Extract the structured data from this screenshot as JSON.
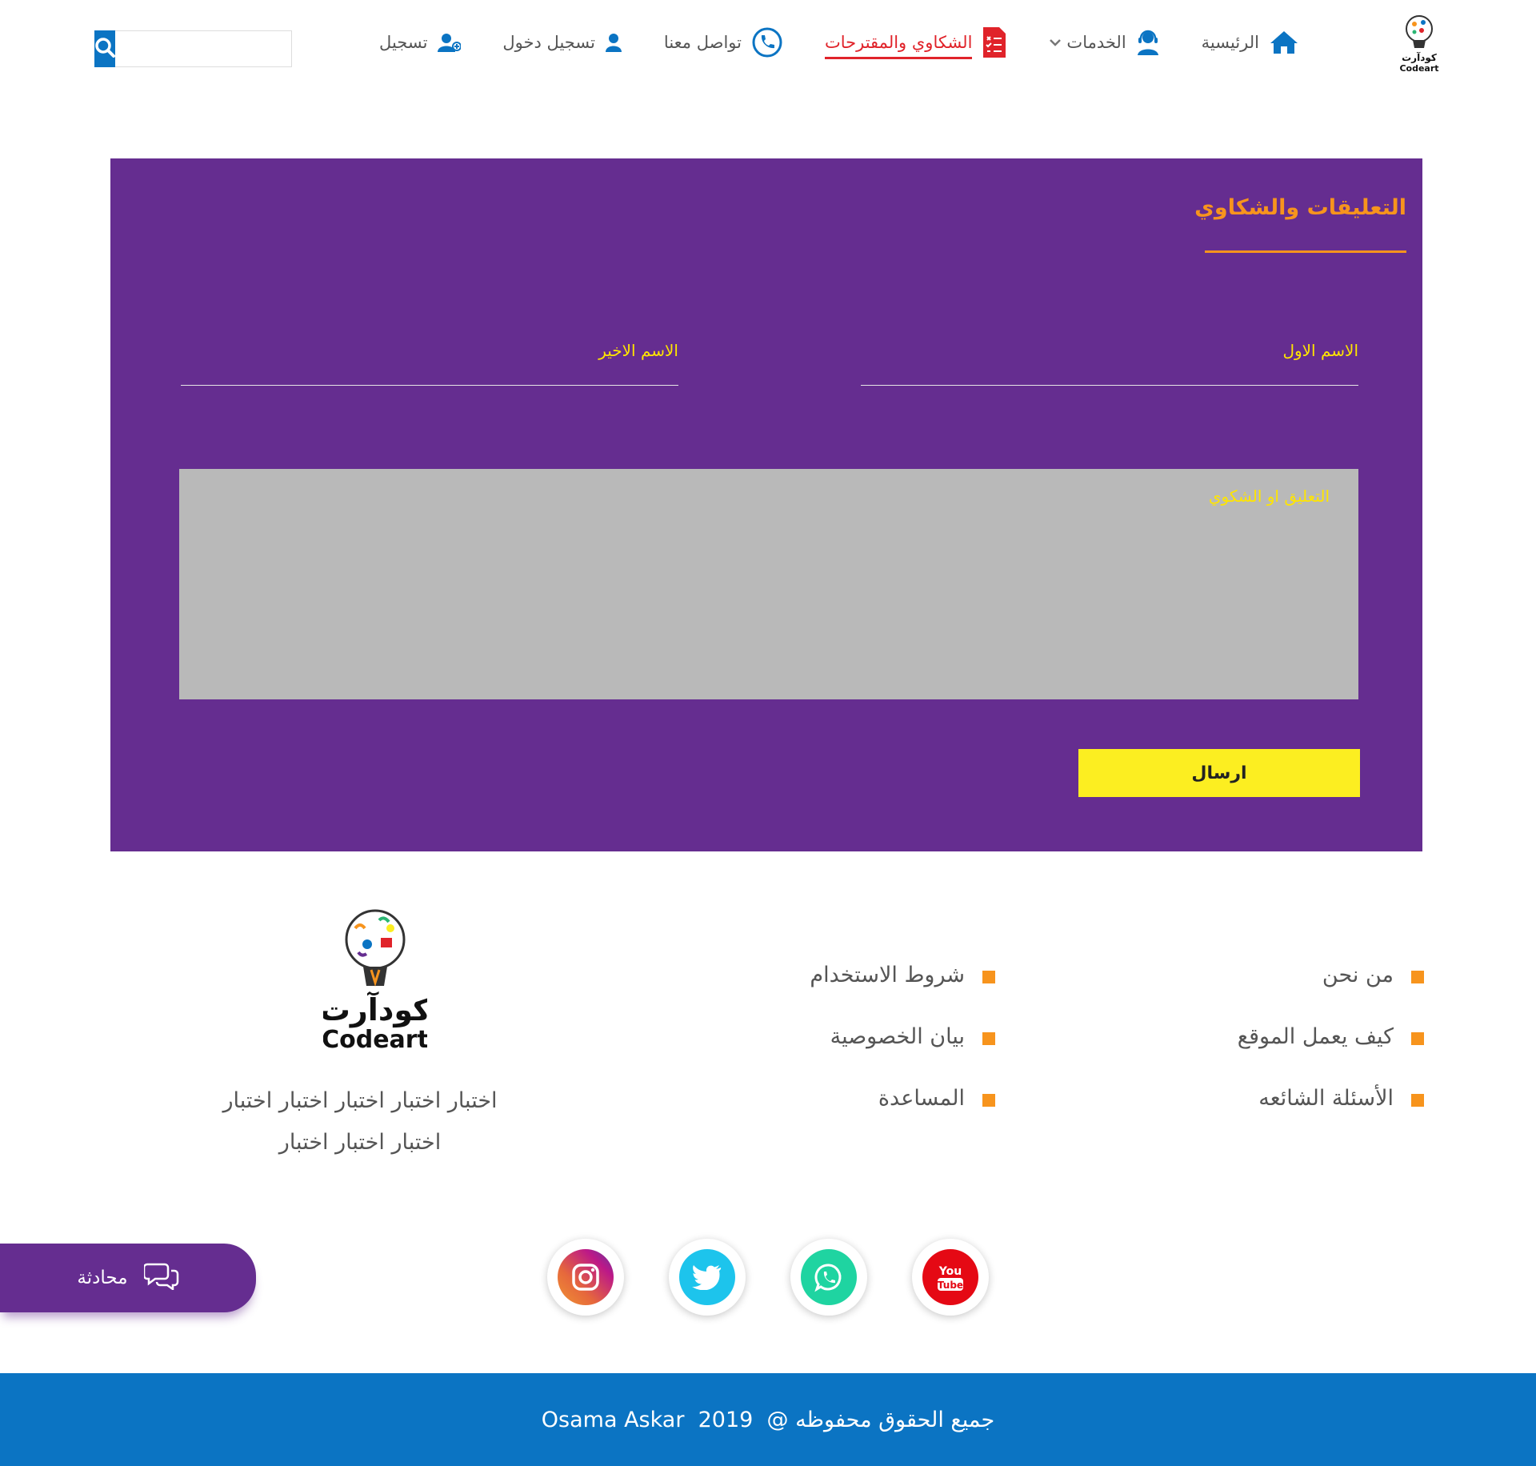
{
  "header": {
    "logo": {
      "text_ar": "كودآرت",
      "text_en": "Codeart"
    },
    "nav": [
      {
        "label": "الرئيسية",
        "icon": "home-icon"
      },
      {
        "label": "الخدمات",
        "icon": "support-agent-icon",
        "has_dropdown": true
      },
      {
        "label": "الشكاوي والمقترحات",
        "icon": "complaints-list-icon",
        "active": true
      },
      {
        "label": "تواصل معنا",
        "icon": "phone-icon"
      },
      {
        "label": "تسجيل دخول",
        "icon": "user-icon"
      },
      {
        "label": "تسجيل",
        "icon": "user-add-icon"
      }
    ],
    "search": {
      "placeholder": "",
      "button_icon": "search-icon"
    }
  },
  "form": {
    "title": "التعليقات والشكاوي",
    "first_name_label": "الاسم الاول",
    "last_name_label": "الاسم الاخير",
    "comment_label": "التعليق او الشكوي",
    "submit_label": "ارسال"
  },
  "footer": {
    "col1": [
      "من نحن",
      "كيف يعمل الموقع",
      "الأسئلة الشائعه"
    ],
    "col2": [
      "شروط الاستخدام",
      "بيان الخصوصية",
      "المساعدة"
    ],
    "about_line1": "اختبار اختبار اختبار اختبار اختبار",
    "about_line2": "اختبار اختبار اختبار",
    "logo": {
      "text_ar": "كودآرت",
      "text_en": "Codeart"
    },
    "social": [
      {
        "name": "youtube-icon",
        "color": "#e50914"
      },
      {
        "name": "whatsapp-icon",
        "color": "#1fd4a1"
      },
      {
        "name": "twitter-icon",
        "color": "#1dc4ec"
      },
      {
        "name": "instagram-icon",
        "color": "#bc1888"
      }
    ]
  },
  "chat": {
    "label": "محادثة",
    "icon": "chat-bubbles-icon"
  },
  "copyright": {
    "text": "جميع الحقوق محفوظه @",
    "year": "2019",
    "author": "Osama Askar"
  },
  "colors": {
    "primary_blue": "#0b74c3",
    "panel_purple": "#652d90",
    "accent_orange": "#f7941d",
    "label_yellow": "#ffe500",
    "button_yellow": "#fcee21",
    "active_red": "#e0232a"
  }
}
